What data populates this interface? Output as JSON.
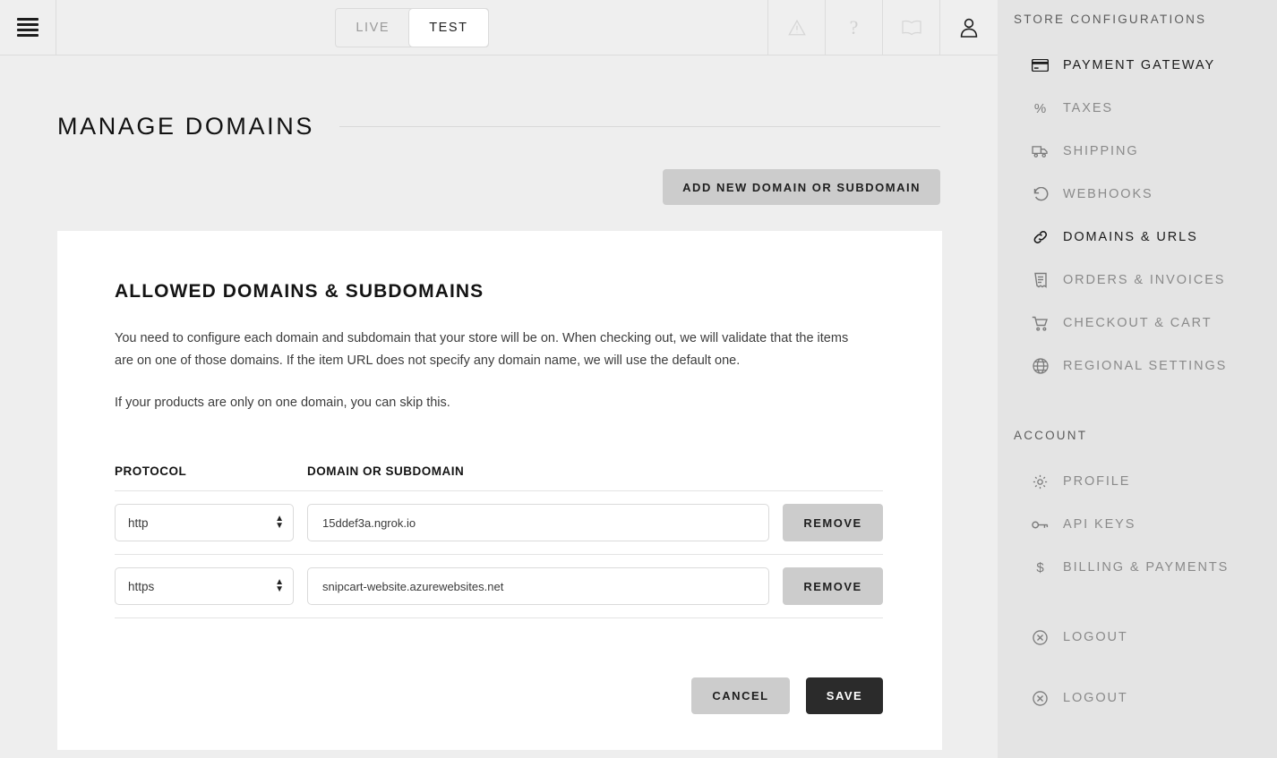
{
  "topbar": {
    "menu_icon": "hamburger-icon",
    "env_toggle": {
      "live": "LIVE",
      "test": "TEST",
      "active": "TEST"
    },
    "icons": [
      {
        "name": "warning-icon",
        "glyph": "triangle-exclamation"
      },
      {
        "name": "help-icon",
        "glyph": "?"
      },
      {
        "name": "docs-icon",
        "glyph": "book"
      },
      {
        "name": "account-icon",
        "glyph": "user"
      }
    ]
  },
  "page": {
    "title": "MANAGE DOMAINS",
    "add_button": "ADD NEW DOMAIN OR SUBDOMAIN"
  },
  "card": {
    "title": "ALLOWED DOMAINS & SUBDOMAINS",
    "paragraph1": "You need to configure each domain and subdomain that your store will be on. When checking out, we will validate that the items are on one of those domains. If the item URL does not specify any domain name, we will use the default one.",
    "paragraph2": "If your products are only on one domain, you can skip this.",
    "table": {
      "headers": [
        "PROTOCOL",
        "DOMAIN OR SUBDOMAIN"
      ],
      "protocol_options": [
        "http",
        "https"
      ],
      "rows": [
        {
          "protocol": "http",
          "domain": "15ddef3a.ngrok.io",
          "remove_label": "REMOVE"
        },
        {
          "protocol": "https",
          "domain": "snipcart-website.azurewebsites.net",
          "remove_label": "REMOVE"
        }
      ]
    },
    "footer": {
      "cancel": "CANCEL",
      "save": "SAVE"
    }
  },
  "sidebar": {
    "store_section_label": "STORE CONFIGURATIONS",
    "account_section_label": "ACCOUNT",
    "store_items": [
      {
        "label": "PAYMENT GATEWAY",
        "icon": "credit-card-icon",
        "active": true
      },
      {
        "label": "TAXES",
        "icon": "percent-icon",
        "active": false
      },
      {
        "label": "SHIPPING",
        "icon": "truck-icon",
        "active": false
      },
      {
        "label": "WEBHOOKS",
        "icon": "undo-arrow-icon",
        "active": false
      },
      {
        "label": "DOMAINS & URLS",
        "icon": "link-icon",
        "active": true
      },
      {
        "label": "ORDERS & INVOICES",
        "icon": "invoice-icon",
        "active": false
      },
      {
        "label": "CHECKOUT & CART",
        "icon": "shopping-cart-icon",
        "active": false
      },
      {
        "label": "REGIONAL SETTINGS",
        "icon": "globe-icon",
        "active": false
      }
    ],
    "account_items": [
      {
        "label": "PROFILE",
        "icon": "gear-icon"
      },
      {
        "label": "API KEYS",
        "icon": "key-icon"
      },
      {
        "label": "BILLING & PAYMENTS",
        "icon": "dollar-icon"
      },
      {
        "label": "LOGOUT",
        "icon": "logout-circle-icon"
      },
      {
        "label": "LOGOUT",
        "icon": "logout-circle-icon"
      }
    ]
  },
  "colors": {
    "page_bg": "#eeeeee",
    "sidebar_bg": "#e4e4e4",
    "card_bg": "#ffffff",
    "btn_grey": "#cccccc",
    "btn_dark": "#2b2b2b",
    "text_dark": "#1b1b1b",
    "text_muted": "#8a8a8a"
  }
}
